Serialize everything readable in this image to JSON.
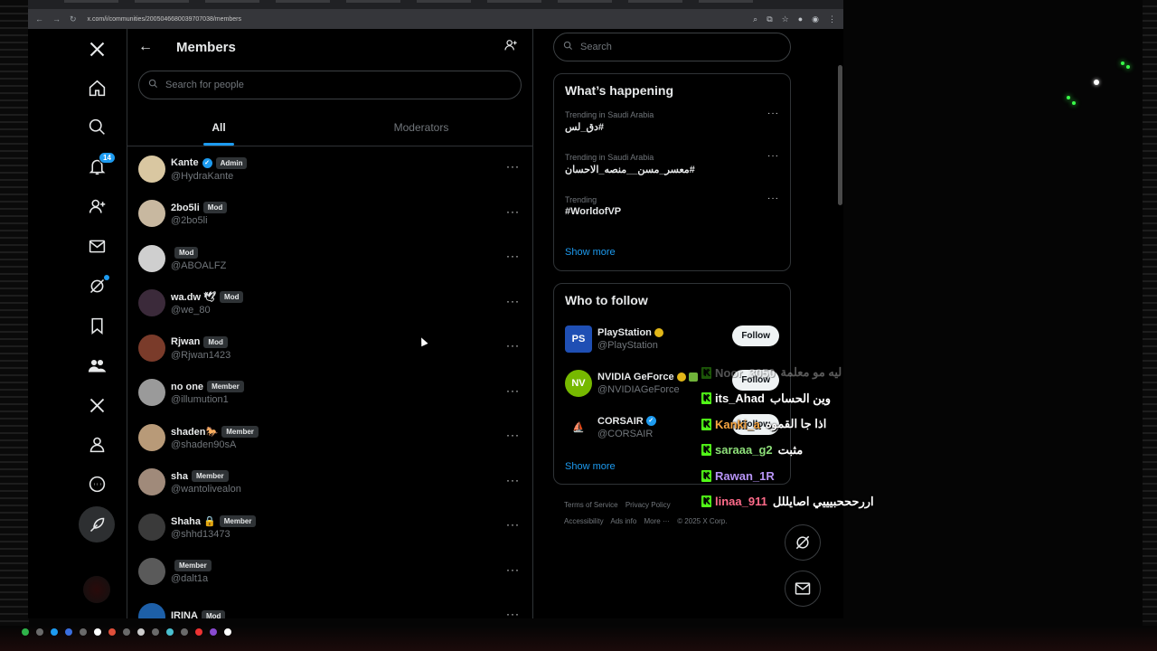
{
  "browser": {
    "url": "x.com/i/communities/2005046680039707038/members"
  },
  "nav": {
    "notifications_badge": "14",
    "icons": [
      "x-logo-icon",
      "home-icon",
      "search-icon",
      "bell-icon",
      "follow-icon",
      "mail-icon",
      "grok-icon",
      "bookmark-icon",
      "communities-icon",
      "x-premium-icon",
      "profile-icon",
      "more-icon",
      "post-icon"
    ]
  },
  "header": {
    "title": "Members"
  },
  "search_people": {
    "placeholder": "Search for people"
  },
  "tabs": [
    {
      "label": "All"
    },
    {
      "label": "Moderators"
    }
  ],
  "members": [
    {
      "name": "Kante",
      "verified": true,
      "role": "Admin",
      "handle": "@HydraKante",
      "avatar_color": "#d9c7a1"
    },
    {
      "name": "2bo5li",
      "verified": false,
      "role": "Mod",
      "handle": "@2bo5li",
      "avatar_color": "#c8b8a0"
    },
    {
      "name": "",
      "verified": false,
      "role": "Mod",
      "handle": "@ABOALFZ",
      "avatar_color": "#cfcfcf"
    },
    {
      "name": "wa.dw 🕊",
      "verified": false,
      "role": "Mod",
      "handle": "@we_80",
      "avatar_color": "#3b2a3a"
    },
    {
      "name": "Rjwan",
      "verified": false,
      "role": "Mod",
      "handle": "@Rjwan1423",
      "avatar_color": "#7a3b2a"
    },
    {
      "name": "no one",
      "verified": false,
      "role": "Member",
      "handle": "@illumution1",
      "avatar_color": "#9a9a9a"
    },
    {
      "name": "shaden🐎",
      "verified": false,
      "role": "Member",
      "handle": "@shaden90sA",
      "avatar_color": "#b89a78"
    },
    {
      "name": "sha",
      "verified": false,
      "role": "Member",
      "handle": "@wantolivealon",
      "avatar_color": "#a08a7a"
    },
    {
      "name": "Shaha 🔒",
      "verified": false,
      "role": "Member",
      "handle": "@shhd13473",
      "avatar_color": "#3a3a3a"
    },
    {
      "name": "",
      "verified": false,
      "role": "Member",
      "handle": "@dalt1a",
      "avatar_color": "#5a5a5a"
    },
    {
      "name": "IRINA",
      "verified": false,
      "role": "Mod",
      "handle": "",
      "avatar_color": "#1d5fa8"
    }
  ],
  "right": {
    "search_placeholder": "Search",
    "happening_title": "What’s happening",
    "trends": [
      {
        "context": "Trending in Saudi Arabia",
        "name": "#دق_لس",
        "rtl": true
      },
      {
        "context": "Trending in Saudi Arabia",
        "name": "#معسر_مسن__منصه_الاحسان",
        "rtl": true
      },
      {
        "context": "Trending",
        "name": "#WorldofVP",
        "rtl": false
      }
    ],
    "show_more": "Show more",
    "wtf_title": "Who to follow",
    "follow": [
      {
        "name": "PlayStation",
        "handle": "@PlayStation",
        "badge": "gold",
        "avatar_color": "#1f4fb4",
        "avatar_glyph": "PS"
      },
      {
        "name": "NVIDIA GeForce",
        "handle": "@NVIDIAGeForce",
        "badge": "gold",
        "avatar_color": "#76b900",
        "avatar_glyph": "NV"
      },
      {
        "name": "CORSAIR",
        "handle": "@CORSAIR",
        "badge": "blue",
        "avatar_color": "#000000",
        "avatar_glyph": "⛵"
      }
    ],
    "follow_label": "Follow",
    "show_more_2": "Show more",
    "footer": [
      "Terms of Service",
      "Privacy Policy",
      "Accessibility",
      "Ads info",
      "More ···",
      "© 2025 X Corp."
    ]
  },
  "chat": [
    {
      "user": "Noor_3050",
      "message": "ليه مو معلمة",
      "user_color": "#e7e9ea",
      "faded": true
    },
    {
      "user": "its_Ahad",
      "message": "وين الحساب",
      "user_color": "#ffffff",
      "faded": false
    },
    {
      "user": "Kanki_a",
      "message": "اذا جا القموه",
      "user_color": "#f7a541",
      "faded": false
    },
    {
      "user": "saraaa_g2",
      "message": "مثبت",
      "user_color": "#8ee07a",
      "faded": false
    },
    {
      "user": "Rawan_1R",
      "message": "",
      "user_color": "#b794f6",
      "faded": false
    },
    {
      "user": "linaa_911",
      "message": "اررحححبيييي اصايللل",
      "user_color": "#ff6b8a",
      "faded": false
    }
  ],
  "colors": {
    "accent": "#1d9bf0",
    "kick_green": "#53fc18"
  }
}
